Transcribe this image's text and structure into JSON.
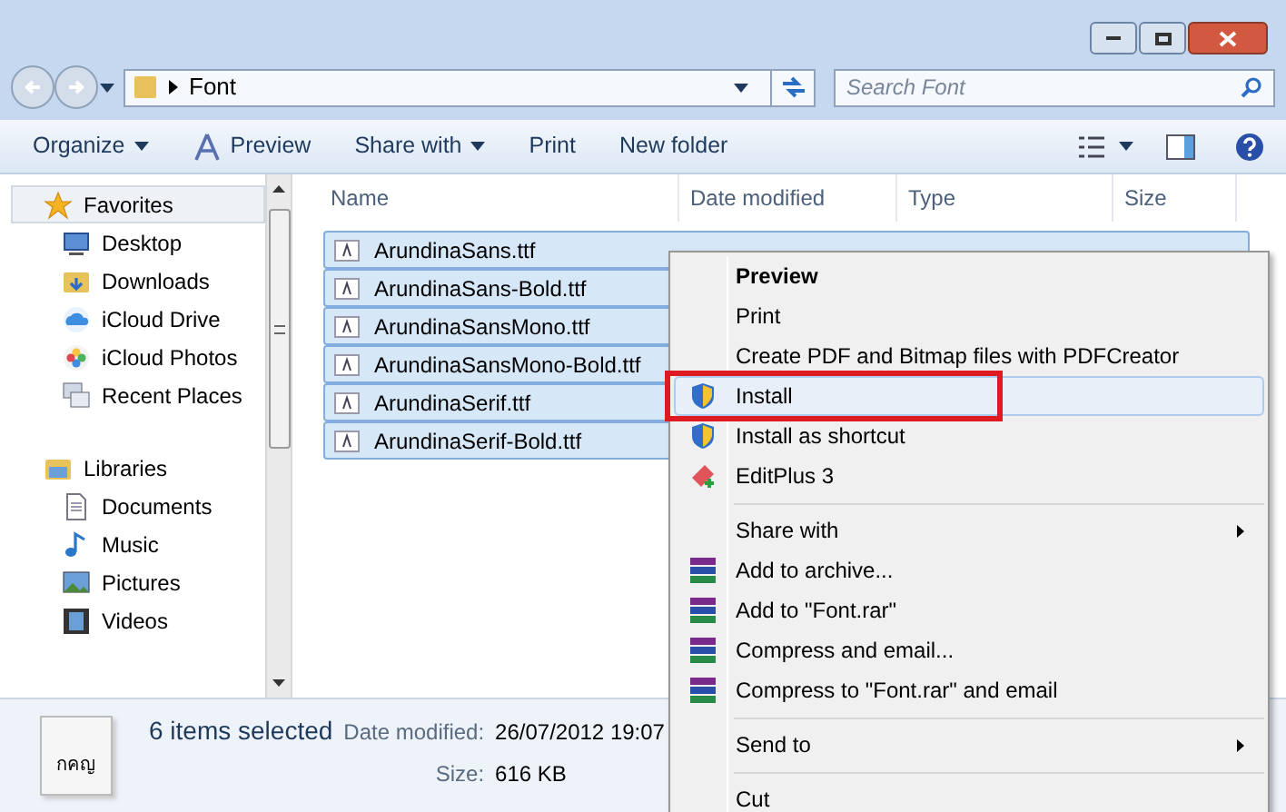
{
  "address": {
    "path": "Font",
    "search_placeholder": "Search Font"
  },
  "toolbar": [
    {
      "label": "Organize",
      "dropdown": true
    },
    {
      "label": "Preview",
      "dropdown": false
    },
    {
      "label": "Share with",
      "dropdown": true
    },
    {
      "label": "Print",
      "dropdown": false
    },
    {
      "label": "New folder",
      "dropdown": false
    }
  ],
  "sidebar": [
    {
      "label": "Favorites",
      "selected": true,
      "children": [
        {
          "label": "Desktop",
          "selected": false
        },
        {
          "label": "Downloads",
          "selected": false
        },
        {
          "label": "iCloud Drive",
          "selected": false
        },
        {
          "label": "iCloud Photos",
          "selected": false
        },
        {
          "label": "Recent Places",
          "selected": false
        }
      ]
    },
    {
      "label": "Libraries",
      "selected": false,
      "children": [
        {
          "label": "Documents",
          "selected": false
        },
        {
          "label": "Music",
          "selected": false
        },
        {
          "label": "Pictures",
          "selected": false
        },
        {
          "label": "Videos",
          "selected": false
        }
      ]
    }
  ],
  "columns": [
    "Name",
    "Date modified",
    "Type",
    "Size"
  ],
  "files": [
    {
      "name": "ArundinaSans.ttf",
      "selected": true
    },
    {
      "name": "ArundinaSans-Bold.ttf",
      "selected": true
    },
    {
      "name": "ArundinaSansMono.ttf",
      "selected": true
    },
    {
      "name": "ArundinaSansMono-Bold.ttf",
      "selected": true
    },
    {
      "name": "ArundinaSerif.ttf",
      "selected": true
    },
    {
      "name": "ArundinaSerif-Bold.ttf",
      "selected": true
    }
  ],
  "context_menu": [
    {
      "kind": "item",
      "label": "Preview",
      "bold": true,
      "highlighted": false,
      "submenu": false
    },
    {
      "kind": "item",
      "label": "Print",
      "bold": false,
      "highlighted": false,
      "submenu": false
    },
    {
      "kind": "item",
      "label": "Create PDF and Bitmap files with PDFCreator",
      "bold": false,
      "highlighted": false,
      "submenu": false
    },
    {
      "kind": "item",
      "label": "Install",
      "bold": false,
      "highlighted": true,
      "submenu": false
    },
    {
      "kind": "item",
      "label": "Install as shortcut",
      "bold": false,
      "highlighted": false,
      "submenu": false
    },
    {
      "kind": "item",
      "label": "EditPlus 3",
      "bold": false,
      "highlighted": false,
      "submenu": false
    },
    {
      "kind": "separator"
    },
    {
      "kind": "item",
      "label": "Share with",
      "bold": false,
      "highlighted": false,
      "submenu": true
    },
    {
      "kind": "item",
      "label": "Add to archive...",
      "bold": false,
      "highlighted": false,
      "submenu": false
    },
    {
      "kind": "item",
      "label": "Add to \"Font.rar\"",
      "bold": false,
      "highlighted": false,
      "submenu": false
    },
    {
      "kind": "item",
      "label": "Compress and email...",
      "bold": false,
      "highlighted": false,
      "submenu": false
    },
    {
      "kind": "item",
      "label": "Compress to \"Font.rar\" and email",
      "bold": false,
      "highlighted": false,
      "submenu": false
    },
    {
      "kind": "separator"
    },
    {
      "kind": "item",
      "label": "Send to",
      "bold": false,
      "highlighted": false,
      "submenu": true
    },
    {
      "kind": "separator"
    },
    {
      "kind": "item",
      "label": "Cut",
      "bold": false,
      "highlighted": false,
      "submenu": false
    }
  ],
  "status": {
    "preview_glyph": "กคญ",
    "summary": "6 items selected",
    "date_label": "Date modified:",
    "date_value": "26/07/2012 19:07",
    "size_label": "Size:",
    "size_value": "616 KB"
  }
}
